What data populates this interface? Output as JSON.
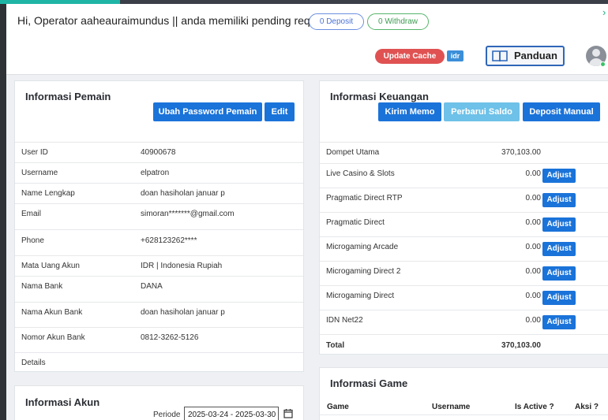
{
  "header": {
    "greeting": "Hi, Operator aaheauraimundus || anda memiliki pending request:",
    "deposit_pill": "0 Deposit",
    "withdraw_pill": "0 Withdraw",
    "update_cache": "Update Cache",
    "currency_badge": "idr",
    "panduan": "Panduan"
  },
  "pemain": {
    "title": "Informasi Pemain",
    "ubah_password": "Ubah Password Pemain",
    "edit": "Edit",
    "rows": [
      {
        "label": "User ID",
        "value": "40900678"
      },
      {
        "label": "Username",
        "value": "elpatron"
      },
      {
        "label": "Name Lengkap",
        "value": "doan hasiholan januar p"
      },
      {
        "label": "Email",
        "value": "simoran*******@gmail.com"
      },
      {
        "label": "Phone",
        "value": "+628123262****"
      },
      {
        "label": "Mata Uang Akun",
        "value": "IDR | Indonesia Rupiah"
      },
      {
        "label": "Nama Bank",
        "value": "DANA"
      },
      {
        "label": "Nama Akun Bank",
        "value": "doan hasiholan januar p"
      },
      {
        "label": "Nomor Akun Bank",
        "value": "0812-3262-5126"
      },
      {
        "label": "Details",
        "value": ""
      }
    ]
  },
  "keuangan": {
    "title": "Informasi Keuangan",
    "kirim_memo": "Kirim Memo",
    "perbarui_saldo": "Perbarui Saldo",
    "deposit_manual": "Deposit Manual",
    "adjust_label": "Adjust",
    "rows": [
      {
        "label": "Dompet Utama",
        "value": "370,103.00"
      },
      {
        "label": "Live Casino & Slots",
        "value": "0.00"
      },
      {
        "label": "Pragmatic Direct RTP",
        "value": "0.00"
      },
      {
        "label": "Pragmatic Direct",
        "value": "0.00"
      },
      {
        "label": "Microgaming Arcade",
        "value": "0.00"
      },
      {
        "label": "Microgaming Direct 2",
        "value": "0.00"
      },
      {
        "label": "Microgaming Direct",
        "value": "0.00"
      },
      {
        "label": "IDN Net22",
        "value": "0.00"
      }
    ],
    "total_label": "Total",
    "total_value": "370,103.00"
  },
  "akun": {
    "title": "Informasi Akun",
    "periode_label": "Periode",
    "periode_value": "2025-03-24 - 2025-03-30"
  },
  "game": {
    "title": "Informasi Game",
    "columns": [
      "Game",
      "Username",
      "Is Active ?",
      "Aksi ?"
    ]
  },
  "colors": {
    "primary": "#1a73d9",
    "danger": "#e05252",
    "accent_teal": "#1fb5a6"
  },
  "icons": [
    "book-icon",
    "calendar-icon",
    "user-avatar-icon",
    "chevron-right-icon"
  ]
}
